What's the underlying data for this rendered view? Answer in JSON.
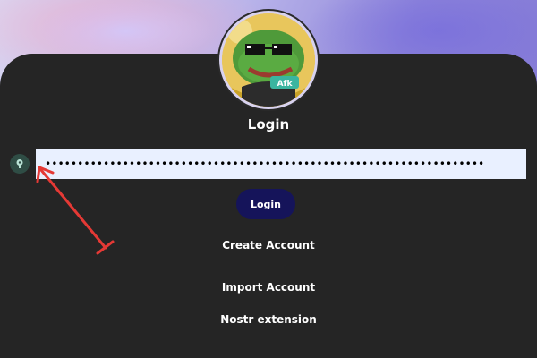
{
  "login": {
    "title": "Login",
    "password_value": "••••••••••••••••••••••••••••••••••••••••••••••••••••••••••••••••••••",
    "login_button": "Login",
    "create_account": "Create Account",
    "import_account": "Import Account",
    "nostr_extension": "Nostr extension"
  },
  "avatar": {
    "badge_text": "Afk"
  },
  "icons": {
    "field_icon": "key-icon",
    "annotation": "red-arrow-annotation"
  },
  "colors": {
    "panel": "#252525",
    "button": "#15145a",
    "field": "#e9f0ff",
    "annotation": "#e53935"
  }
}
